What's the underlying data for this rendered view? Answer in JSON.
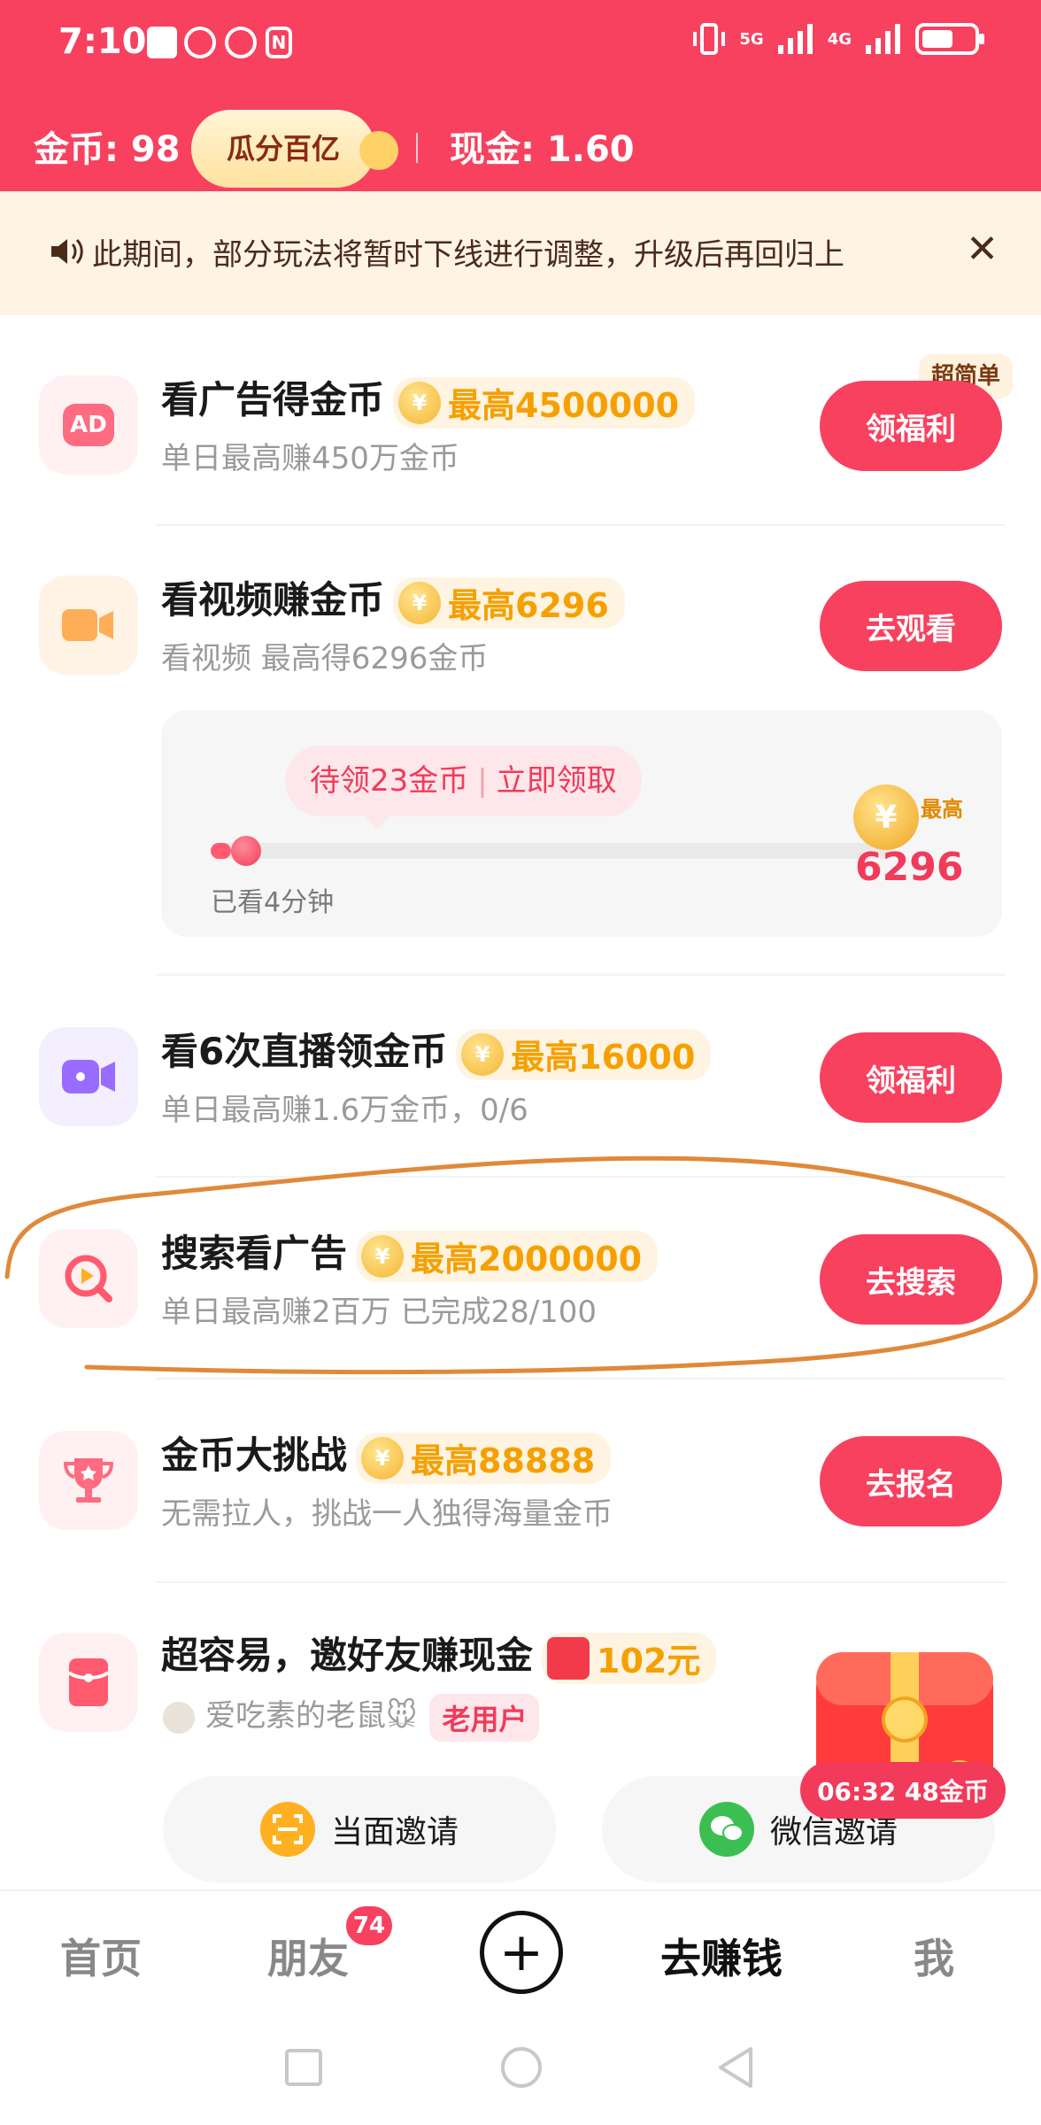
{
  "status_bar": {
    "time": "7:10",
    "network_5g": "5G",
    "network_4g": "4G",
    "battery_percent": 60
  },
  "header": {
    "coins_text": "金币: 98",
    "promo_label": "瓜分百亿",
    "cash_text": "现金: 1.60"
  },
  "notice": {
    "text": "此期间，部分玩法将暂时下线进行调整，升级后再回归上",
    "close": "✕"
  },
  "tasks": [
    {
      "title": "看广告得金币",
      "reward": "最高4500000",
      "sub": "单日最高赚450万金币",
      "button": "领福利",
      "tag": "超简单",
      "icon": "ad-icon"
    },
    {
      "title": "看视频赚金币",
      "reward": "最高6296",
      "sub": "看视频 最高得6296金币",
      "button": "去观看",
      "icon": "video-camera-icon"
    },
    {
      "title": "看6次直播领金币",
      "reward": "最高16000",
      "sub": "单日最高赚1.6万金币，0/6",
      "button": "领福利",
      "icon": "live-camera-icon"
    },
    {
      "title": "搜索看广告",
      "reward": "最高2000000",
      "sub": "单日最高赚2百万 已完成28/100",
      "button": "去搜索",
      "icon": "search-play-icon"
    },
    {
      "title": "金币大挑战",
      "reward": "最高88888",
      "sub": "无需拉人，挑战一人独得海量金币",
      "button": "去报名",
      "icon": "trophy-icon"
    },
    {
      "title": "超容易，邀好友赚现金",
      "reward": "102元",
      "sub_name": "爱吃素的老鼠🐭",
      "sub_tag": "老用户",
      "icon": "red-envelope-icon"
    }
  ],
  "video_card": {
    "pending": "待领23金币",
    "claim": "立即领取",
    "watched": "已看4分钟",
    "max_label": "最高",
    "max_value": "6296",
    "progress": 0.03
  },
  "invite": {
    "face_to_face": "当面邀请",
    "wechat": "微信邀请"
  },
  "floating_gift": {
    "timer": "06:32 48金币"
  },
  "bottom_nav": {
    "home": "首页",
    "friends": "朋友",
    "friends_badge": "74",
    "plus": "+",
    "earn": "去赚钱",
    "me": "我"
  },
  "colors": {
    "brand_red": "#f7415f",
    "reward_orange": "#f5a000",
    "highlight_orange": "#e0893a"
  }
}
